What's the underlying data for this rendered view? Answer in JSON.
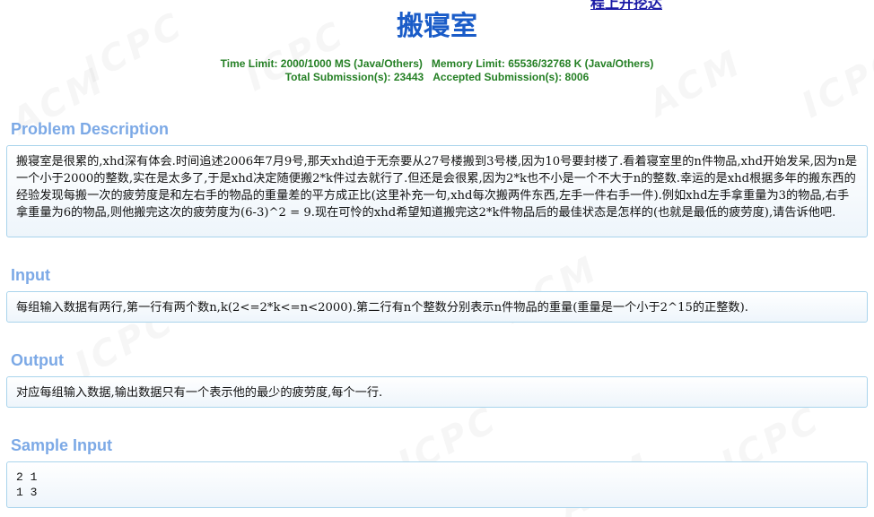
{
  "problem": {
    "title": "搬寝室",
    "top_link_fragment": "程上开挖达",
    "time_limit": "Time Limit: 2000/1000 MS (Java/Others)",
    "memory_limit": "Memory Limit: 65536/32768 K (Java/Others)",
    "total_submissions": "Total Submission(s): 23443",
    "accepted_submissions": "Accepted Submission(s): 8006"
  },
  "sections": {
    "description": {
      "heading": "Problem Description",
      "text": "搬寝室是很累的,xhd深有体会.时间追述2006年7月9号,那天xhd迫于无奈要从27号楼搬到3号楼,因为10号要封楼了.看着寝室里的n件物品,xhd开始发呆,因为n是一个小于2000的整数,实在是太多了,于是xhd决定随便搬2*k件过去就行了.但还是会很累,因为2*k也不小是一个不大于n的整数.幸运的是xhd根据多年的搬东西的经验发现每搬一次的疲劳度是和左右手的物品的重量差的平方成正比(这里补充一句,xhd每次搬两件东西,左手一件右手一件).例如xhd左手拿重量为3的物品,右手拿重量为6的物品,则他搬完这次的疲劳度为(6-3)^2 = 9.现在可怜的xhd希望知道搬完这2*k件物品后的最佳状态是怎样的(也就是最低的疲劳度),请告诉他吧."
    },
    "input": {
      "heading": "Input",
      "text": "每组输入数据有两行,第一行有两个数n,k(2<=2*k<=n<2000).第二行有n个整数分别表示n件物品的重量(重量是一个小于2^15的正整数)."
    },
    "output": {
      "heading": "Output",
      "text": "对应每组输入数据,输出数据只有一个表示他的最少的疲劳度,每个一行."
    },
    "sample_input": {
      "heading": "Sample Input",
      "text": "2 1\n1 3"
    }
  },
  "watermark": {
    "words": [
      "ACM",
      "ICPC"
    ]
  },
  "colors": {
    "title": "#1a5cc8",
    "meta": "#258025",
    "section_heading": "#7ca9e6",
    "panel_border": "#a9d4ec"
  }
}
